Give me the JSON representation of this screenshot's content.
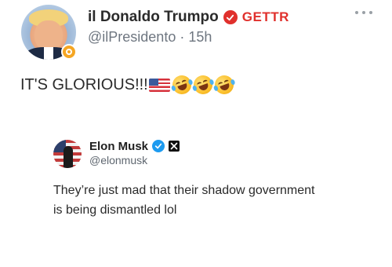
{
  "post": {
    "display_name": "il Donaldo Trumpo",
    "platform_label": "GETTR",
    "handle": "@ilPresidento",
    "separator": "·",
    "time": "15h",
    "text": "IT'S GLORIOUS!!!",
    "emojis": [
      "us-flag-emoji",
      "rolling-laughing-emoji",
      "rolling-laughing-emoji",
      "rolling-laughing-emoji"
    ]
  },
  "quoted_post": {
    "display_name": "Elon Musk",
    "handle": "@elonmusk",
    "line1": "They’re just mad that their shadow government",
    "line2": "is being dismantled lol"
  },
  "colors": {
    "gettr_red": "#e0302c",
    "verified_blue": "#1d9bf0",
    "handle_gray": "#6e7680"
  }
}
